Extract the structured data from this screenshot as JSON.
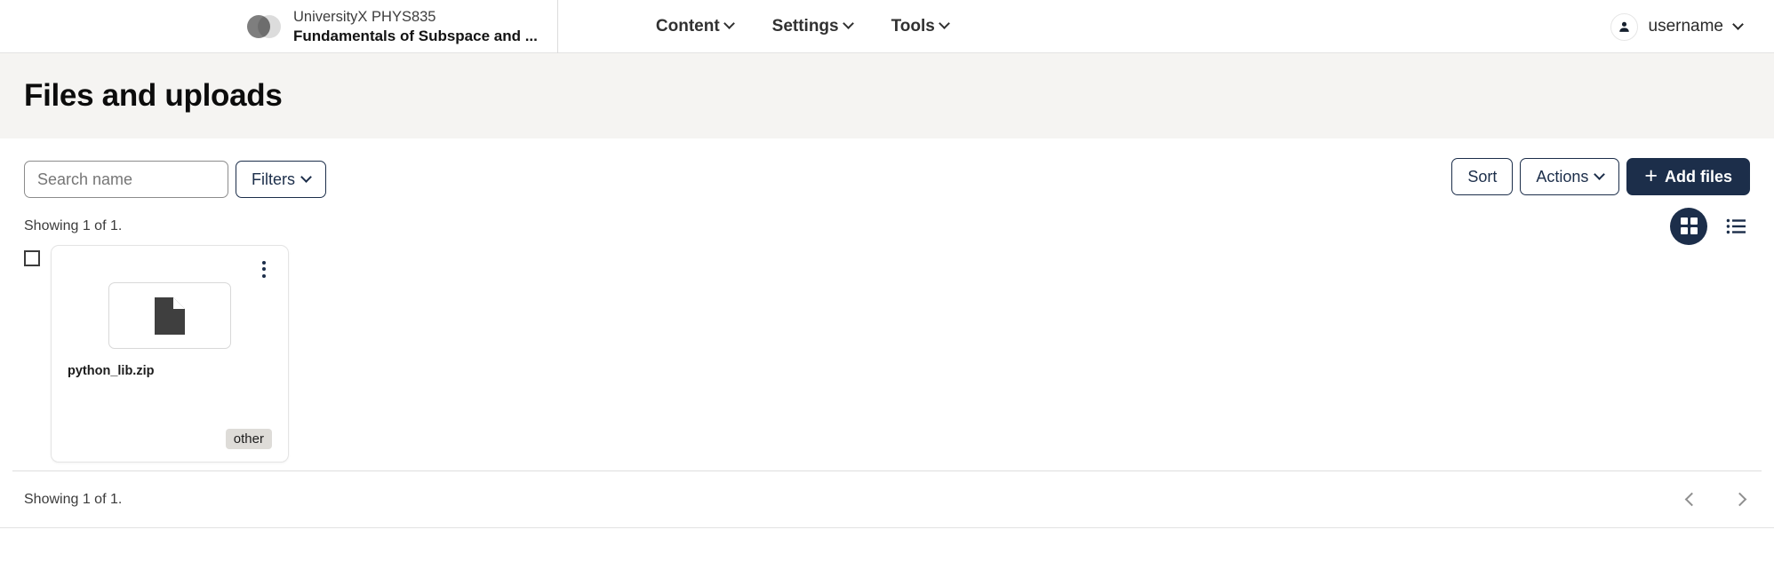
{
  "header": {
    "logo_icon": "two-circles-logo",
    "org": "UniversityX PHYS835",
    "course": "Fundamentals of Subspace and ...",
    "nav": [
      {
        "label": "Content",
        "icon": "chevron-down-icon"
      },
      {
        "label": "Settings",
        "icon": "chevron-down-icon"
      },
      {
        "label": "Tools",
        "icon": "chevron-down-icon"
      }
    ],
    "user": {
      "avatar_icon": "person-icon",
      "label": "username",
      "chevron_icon": "chevron-down-icon"
    }
  },
  "page": {
    "title": "Files and uploads"
  },
  "toolbar": {
    "search_placeholder": "Search name",
    "search_value": "",
    "filters_label": "Filters",
    "sort_label": "Sort",
    "actions_label": "Actions",
    "add_files_label": "Add files",
    "add_files_icon": "plus-icon"
  },
  "results": {
    "count_top": "Showing 1 of 1.",
    "count_bottom": "Showing 1 of 1.",
    "grid_view_icon": "grid-view-icon",
    "list_view_icon": "list-view-icon",
    "active_view": "grid"
  },
  "files": [
    {
      "name": "python_lib.zip",
      "badge": "other",
      "thumb_icon": "document-file-icon",
      "menu_icon": "kebab-menu-icon",
      "selected": false
    }
  ],
  "pagination": {
    "prev_icon": "chevron-left-icon",
    "next_icon": "chevron-right-icon"
  },
  "colors": {
    "accent_navy": "#1c2e4a",
    "title_band": "#f5f4f2",
    "badge_bg": "#dedcd8",
    "doc_icon": "#3f3f3f"
  }
}
